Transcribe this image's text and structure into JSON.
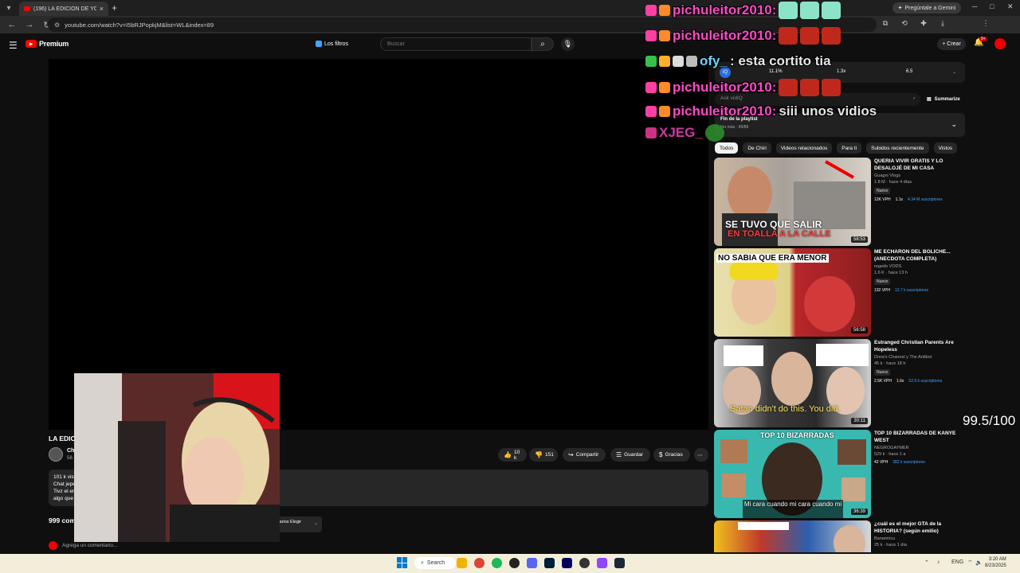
{
  "browser": {
    "tab_title": "(196) LA EDICION DE YOUTUBE",
    "url": "youtube.com/watch?v=I5bRJPopkjM&list=WL&index=89",
    "gemini_button": "Pregúntale a Gemini"
  },
  "youtube": {
    "logo_text": "Premium",
    "filters_label": "Los filtros",
    "search_placeholder": "Buscar",
    "create_label": "Crear",
    "notif_count": "9+"
  },
  "video": {
    "title": "LA EDIC",
    "channel": "Ch",
    "subs": "58.",
    "likes": "10 k",
    "dislikes": "151",
    "share": "Compartir",
    "save": "Guardar",
    "thanks": "Gracias",
    "description_lines": [
      "101 k vist",
      "Chat jepe",
      "Tivz el err",
      "algo que"
    ],
    "comments_count": "999 com",
    "sort_label": "ntarios Elegir",
    "add_comment": "Agrega un comentario..."
  },
  "vidiq": {
    "stats": [
      "11.1%",
      "1.3x",
      "6.5"
    ],
    "ask_placeholder": "Ask vidIQ",
    "summarize": "Summarize"
  },
  "playlist": {
    "title": "Fin de la playlist",
    "sub": "Ver más · 89/89"
  },
  "chips": [
    "Todos",
    "De Chiri",
    "Videos relacionados",
    "Para ti",
    "Subidos recientemente",
    "Vistos"
  ],
  "recommendations": [
    {
      "title": "QUERIA VIVIR GRATIS Y LO DESALOJÉ DE MI CASA",
      "channel": "Guagni Vlogs",
      "meta": "1.8 M · hace 4 días",
      "new": "Nuevo",
      "vph": "12K VPH",
      "mult": "1.1x",
      "subs": "4.34 M suscriptores",
      "duration": "58:53",
      "caption": [
        "SE TUVO QUE SALIR",
        "EN TOALLA A LA CALLE"
      ]
    },
    {
      "title": "ME ECHARON DEL BOLICHE... (ANECDOTA COMPLETA)",
      "channel": "regedo VODS",
      "meta": "1.6 K · hace 13 h",
      "new": "Nuevo",
      "vph": "132 VPH",
      "mult": "",
      "subs": "12.7 k suscriptores",
      "duration": "56:58",
      "caption": [
        "NO SABIA QUE ERA MENOR"
      ]
    },
    {
      "title": "Estranged Christian Parents Are Hopeless",
      "channel": "Drew's Channel y The Antibot",
      "meta": "45 k · hace 18 h",
      "new": "Nuevo",
      "vph": "2.5K VPH",
      "mult": "1.6x",
      "subs": "52.9 k suscriptores",
      "duration": "30:11",
      "caption": [
        "Satan didn't do this. You did."
      ]
    },
    {
      "title": "TOP 10 BIZARRADAS DE KANYE WEST",
      "channel": "NEGROGAYMER",
      "meta": "529 k · hace 1 a",
      "new": "",
      "vph": "42 VPH",
      "mult": "",
      "subs": "382 k suscriptores",
      "duration": "36:39",
      "caption": [
        "TOP 10 BIZARRADAS",
        "Mi cara cuando mi cara cuando mi"
      ]
    },
    {
      "title": "¿cuál es el mejor GTA de la HISTORIA? (según emilio)",
      "channel": "Banamircu",
      "meta": "25 k · hace 1 día",
      "new": "",
      "vph": "",
      "mult": "",
      "subs": "",
      "duration": "",
      "caption": []
    }
  ],
  "overlay": {
    "score": "99.5/100",
    "chat": [
      {
        "name": "pichuleitor2010:",
        "msg": ""
      },
      {
        "name": "pichuleitor2010:",
        "msg": ""
      },
      {
        "name": "ofy_",
        "msg": ": esta cortito tia"
      },
      {
        "name": "pichuleitor2010:",
        "msg": ""
      },
      {
        "name": "pichuleitor2010:",
        "msg": "siii unos vidios"
      },
      {
        "name": "XJEG_",
        "msg": ""
      }
    ]
  },
  "taskbar": {
    "search": "Search",
    "lang": "ENG",
    "time": "3:20 AM",
    "date": "8/23/2025"
  },
  "colors": {
    "accent": "#ff0000",
    "vidiq_blue": "#3ea6ff",
    "chat_name": "#ff49c8"
  }
}
